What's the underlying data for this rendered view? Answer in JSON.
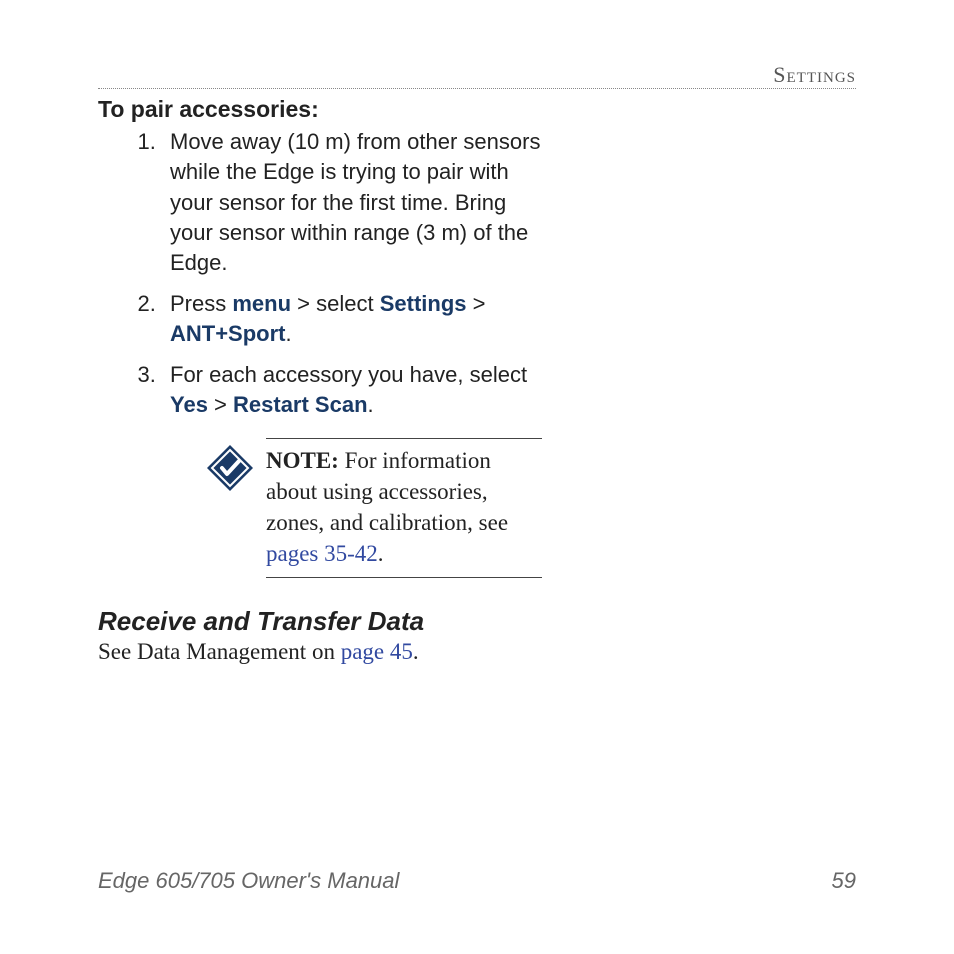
{
  "header": {
    "section": "Settings"
  },
  "pair": {
    "title": "To pair accessories:",
    "step1": "Move away (10 m) from other sensors while the Edge is trying to pair with your sensor for the first time. Bring your sensor within range (3 m) of the Edge.",
    "step2": {
      "prefix": "Press ",
      "menu": "menu",
      "mid1": " > select ",
      "settings": "Settings",
      "mid2": " > ",
      "ant": "ANT+Sport",
      "suffix": "."
    },
    "step3": {
      "prefix": "For each accessory you have, select ",
      "yes": "Yes",
      "mid": " > ",
      "restart": "Restart Scan",
      "suffix": "."
    }
  },
  "note": {
    "label": "NOTE:",
    "body": " For information about using accessories, zones, and calibration, see ",
    "link": "pages 35-42",
    "suffix": "."
  },
  "receive": {
    "heading": "Receive and Transfer Data",
    "prefix": "See Data Management on ",
    "link": "page 45",
    "suffix": "."
  },
  "footer": {
    "manual": "Edge 605/705 Owner's Manual",
    "page": "59"
  }
}
